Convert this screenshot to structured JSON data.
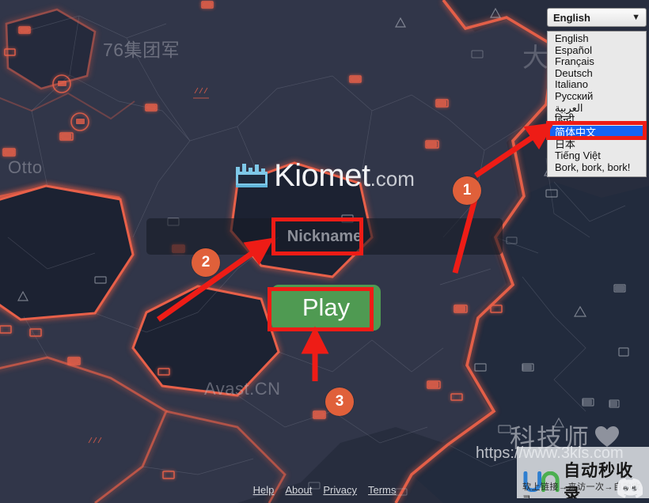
{
  "page": {
    "site_name": "Kiomet",
    "site_tld": ".com"
  },
  "language_select": {
    "current": "English",
    "caret": "chevron-down-icon",
    "selected_option": "简体中文",
    "options": [
      "English",
      "Español",
      "Français",
      "Deutsch",
      "Italiano",
      "Русский",
      "العربية",
      "हिन्दी",
      "简体中文",
      "日本",
      "Tiếng Việt",
      "Bork, bork, bork!"
    ]
  },
  "nickname": {
    "placeholder": "Nickname",
    "value": ""
  },
  "play": {
    "label": "Play"
  },
  "footer": {
    "links": [
      "Help",
      "About",
      "Privacy",
      "Terms"
    ],
    "discord": "discord-icon"
  },
  "map_labels": {
    "army": "76集团军",
    "otto": "Otto",
    "avast": "Avast.CN",
    "da": "大"
  },
  "watermark": {
    "brand": "科技师",
    "heart": "heart-icon",
    "url": "https://www.3kis.com",
    "badge_title": "自动秒收录",
    "badge_sub": "软上链接→来访一次→自动收录"
  },
  "annotations": {
    "steps": [
      {
        "number": "1",
        "target": "language-option-chinese"
      },
      {
        "number": "2",
        "target": "nickname-input"
      },
      {
        "number": "3",
        "target": "play-button"
      }
    ]
  },
  "colors": {
    "territory_border": "#e8604a",
    "territory_fill": "#1e2636",
    "unclaimed": "#293042",
    "play_green": "#4f9a52",
    "annotation_red": "#ee1c16",
    "annotation_circle": "#e0603a",
    "select_highlight": "#1464f4"
  }
}
